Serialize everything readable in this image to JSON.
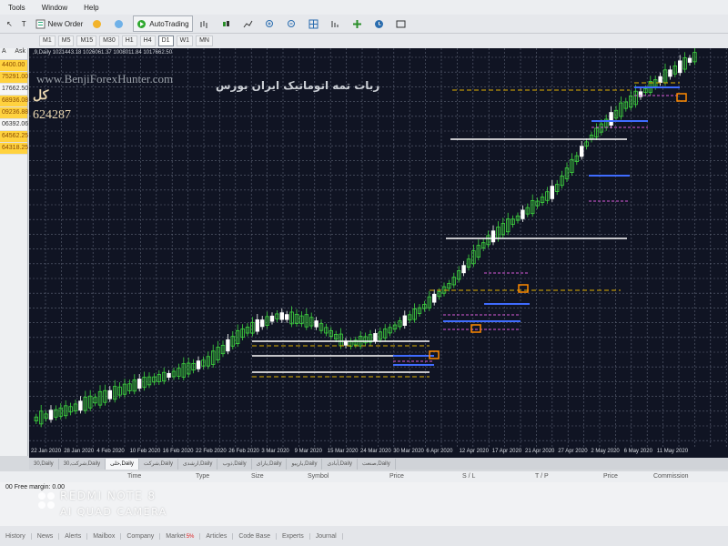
{
  "menu": {
    "items": [
      "Tools",
      "Window",
      "Help"
    ]
  },
  "toolbar": {
    "new_order_label": "New Order",
    "autotrading_label": "AutoTrading",
    "timeframes": [
      "M1",
      "M5",
      "M15",
      "M30",
      "H1",
      "H4",
      "D1",
      "W1",
      "MN"
    ]
  },
  "market_watch": {
    "header_left": "A",
    "header_right": "Ask",
    "rows": [
      "4400.00",
      "75291.00",
      "17662.50",
      "68936.08",
      "09236.88",
      "06392.06",
      "64562.25",
      "64318.25"
    ]
  },
  "chart": {
    "info_line": ",9,Daily   1021443.18 1026061.37 1008011.84 1017662.50",
    "watermark_url": "www.BenjiForexHunter.com",
    "watermark_fa": "ربات تمه اتوماتیک ایران بورس",
    "total_label": "کل",
    "total_value": "624287",
    "x_labels": [
      "22 Jan 2020",
      "28 Jan 2020",
      "4 Feb 2020",
      "10 Feb 2020",
      "16 Feb 2020",
      "22 Feb 2020",
      "26 Feb 2020",
      "3 Mar 2020",
      "9 Mar 2020",
      "15 Mar 2020",
      "24 Mar 2020",
      "30 Mar 2020",
      "6 Apr 2020",
      "12 Apr 2020",
      "17 Apr 2020",
      "21 Apr 2020",
      "27 Apr 2020",
      "2 May 2020",
      "6 May 2020",
      "11 May 2020"
    ],
    "colors": {
      "background": "#101423",
      "grid": "#5e6577",
      "bull": "#3fd63f",
      "bear": "#ffffff",
      "level_white": "#ffffff",
      "level_yellow": "#e0b100",
      "level_blue": "#3f6cff",
      "level_magenta": "#d85ad8",
      "level_orange": "#ff8a00"
    }
  },
  "chart_data": {
    "type": "candlestick",
    "x": [
      "22 Jan 2020",
      "28 Jan 2020",
      "4 Feb 2020",
      "10 Feb 2020",
      "16 Feb 2020",
      "22 Feb 2020",
      "26 Feb 2020",
      "3 Mar 2020",
      "9 Mar 2020",
      "15 Mar 2020",
      "24 Mar 2020",
      "30 Mar 2020",
      "6 Apr 2020",
      "12 Apr 2020",
      "17 Apr 2020",
      "21 Apr 2020",
      "27 Apr 2020",
      "2 May 2020",
      "6 May 2020",
      "11 May 2020"
    ],
    "series": [
      {
        "values": [
          0.03,
          0.06,
          0.1,
          0.14,
          0.17,
          0.21,
          0.3,
          0.35,
          0.33,
          0.26,
          0.29,
          0.36,
          0.45,
          0.58,
          0.66,
          0.74,
          0.9,
          1.0,
          1.08,
          1.15
        ]
      }
    ]
  },
  "tabs": [
    "30,Daily",
    "شرکت,30,Daily",
    "خلی,Daily",
    "شرکت,Daily",
    "ارشدی,Daily",
    "ذوب,Daily",
    "یارای,Daily",
    "یارپیو,Daily",
    "آبادی,Daily",
    "صنعت,Daily"
  ],
  "terminal": {
    "columns": [
      "Time",
      "Type",
      "Size",
      "Symbol",
      "Price",
      "S / L",
      "T / P",
      "Price",
      "Commission"
    ],
    "margin_text": "00  Free margin: 0.00"
  },
  "bottom_tabs": [
    "History",
    "News",
    "Alerts",
    "Mailbox",
    "Company",
    "Market",
    "Articles",
    "Code Base",
    "Experts",
    "Journal"
  ],
  "market_badge": "5%",
  "camera": {
    "line1": "REDMI NOTE 8",
    "line2": "AI QUAD CAMERA"
  }
}
